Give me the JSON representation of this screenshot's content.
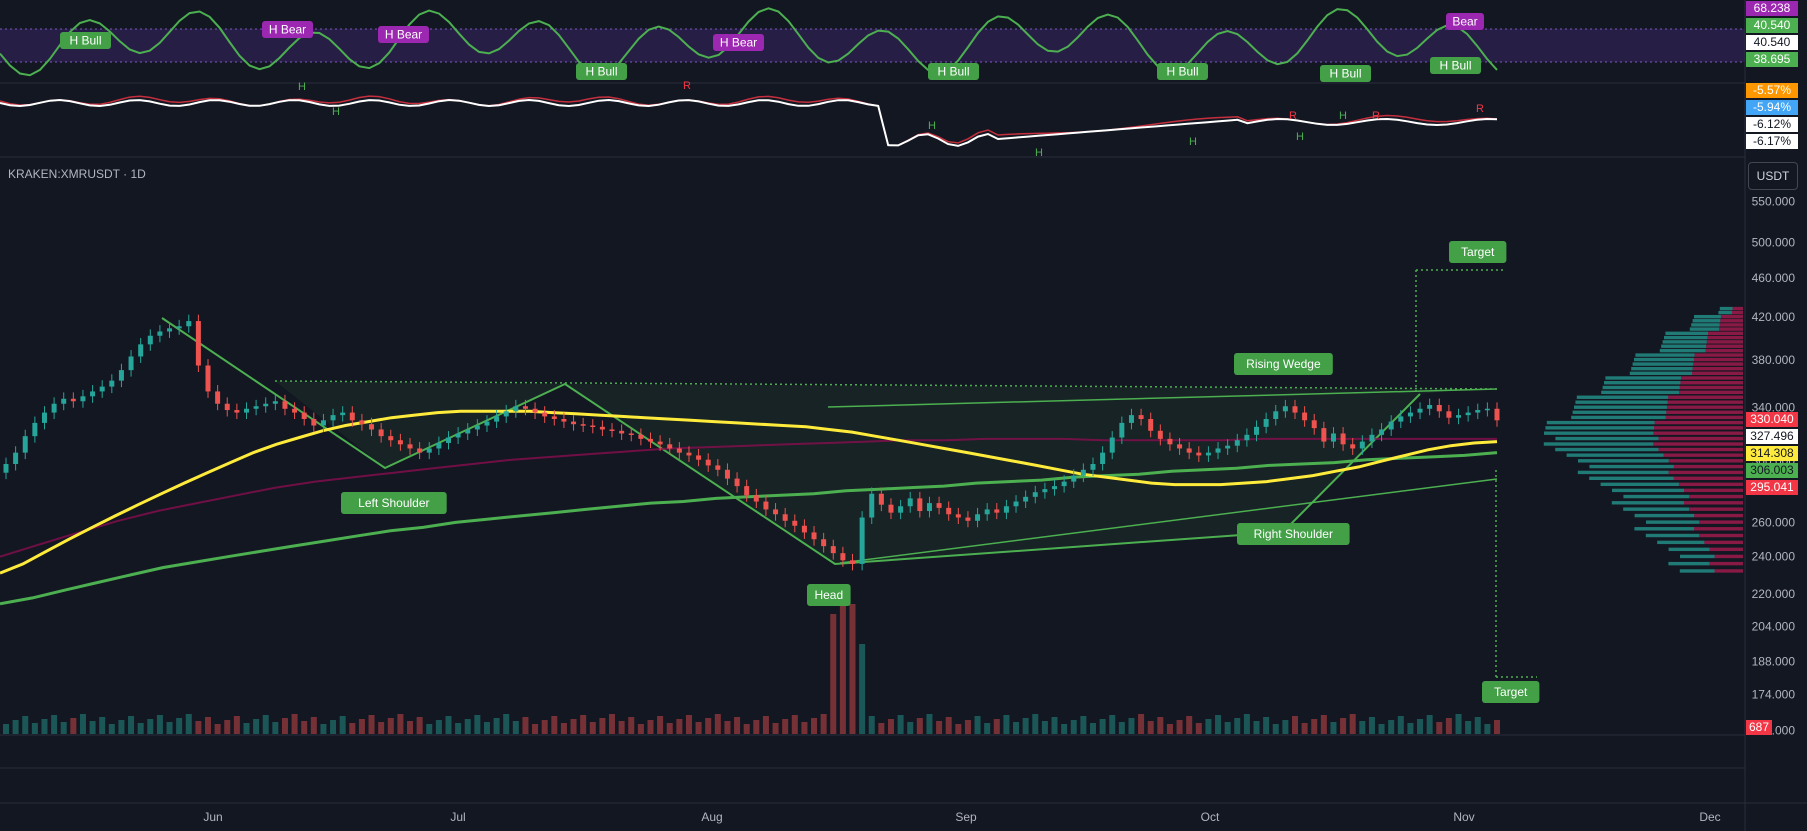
{
  "symbol": "KRAKEN:XMRUSDT · 1D",
  "currency_button": "USDT",
  "colors": {
    "background": "#131722",
    "up": "#26a69a",
    "down": "#ef5350",
    "pattern": "#4caf50",
    "ema_fast": "#ffeb3b",
    "rsi": "#4caf50",
    "bear_tag": "#9c27b0",
    "bull_tag": "#43a047"
  },
  "rsi_panel": {
    "divergence_labels": [
      "H Bull",
      "H Bear",
      "H Bear",
      "H Bull",
      "H Bear",
      "H Bull",
      "H Bull",
      "H Bull",
      "H Bull",
      "Bear"
    ],
    "scale_badges": [
      "68.238",
      "40.540",
      "40.540",
      "38.695"
    ]
  },
  "osc_panel": {
    "markers": [
      "H",
      "H",
      "R",
      "H",
      "H",
      "H",
      "R",
      "H",
      "H",
      "R",
      "R"
    ],
    "scale_badges": [
      "-5.57%",
      "-5.94%",
      "-6.12%",
      "-6.17%"
    ]
  },
  "chart_data": {
    "type": "candlestick",
    "title": "KRAKEN:XMRUSDT · 1D",
    "x_axis_labels": [
      "Jun",
      "Jul",
      "Aug",
      "Sep",
      "Oct",
      "Nov",
      "Dec"
    ],
    "y_axis_ticks": [
      "550.000",
      "500.000",
      "460.000",
      "420.000",
      "380.000",
      "340.000",
      "300.000",
      "260.000",
      "240.000",
      "220.000",
      "204.000",
      "188.000",
      "174.000",
      "160.000"
    ],
    "y_tick_values": [
      550,
      500,
      460,
      420,
      380,
      340,
      300,
      260,
      240,
      220,
      204,
      188,
      174,
      160
    ],
    "y_scale": "log",
    "price_badges": [
      {
        "text": "330.040",
        "color": "#f23645"
      },
      {
        "text": "327.496",
        "color": "#ffffff"
      },
      {
        "text": "314.308",
        "color": "#ffeb3b"
      },
      {
        "text": "306.003",
        "color": "#4caf50"
      },
      {
        "text": "295.041",
        "color": "#f23645"
      }
    ],
    "volume_badge": "687",
    "closes": [
      298,
      306,
      318,
      328,
      336,
      343,
      347,
      345,
      349,
      353,
      357,
      362,
      371,
      383,
      394,
      402,
      406,
      409,
      411,
      416,
      375,
      353,
      343,
      338,
      336,
      339,
      341,
      343,
      345,
      339,
      336,
      331,
      326,
      330,
      334,
      336,
      330,
      327,
      323,
      318,
      315,
      312,
      309,
      306,
      309,
      313,
      317,
      320,
      323,
      326,
      329,
      333,
      337,
      341,
      339,
      336,
      333,
      331,
      329,
      327,
      326,
      325,
      323,
      322,
      320,
      319,
      316,
      314,
      312,
      309,
      306,
      304,
      301,
      297,
      294,
      288,
      283,
      277,
      273,
      268,
      265,
      261,
      258,
      254,
      250,
      246,
      242,
      238,
      236,
      263,
      278,
      271,
      266,
      270,
      275,
      267,
      272,
      269,
      265,
      263,
      261,
      265,
      268,
      266,
      270,
      273,
      276,
      279,
      281,
      283,
      286,
      290,
      294,
      298,
      306,
      317,
      328,
      334,
      331,
      322,
      316,
      312,
      309,
      306,
      304,
      306,
      309,
      311,
      315,
      319,
      325,
      331,
      337,
      341,
      336,
      330,
      324,
      314,
      320,
      312,
      309,
      314,
      319,
      323,
      329,
      333,
      336,
      339,
      342,
      337,
      332,
      334,
      336,
      338,
      339,
      330
    ],
    "ema_fast": [
      231,
      236,
      243,
      250,
      257,
      264,
      271,
      278,
      285,
      292,
      299,
      306,
      312,
      317,
      322,
      326,
      329,
      332,
      334,
      336,
      337,
      337,
      337,
      337,
      336,
      335,
      334,
      333,
      332,
      331,
      330,
      329,
      328,
      327,
      326,
      325,
      323,
      321,
      318,
      315,
      312,
      309,
      306,
      303,
      300,
      297,
      294,
      291,
      289,
      287,
      285,
      284,
      284,
      284,
      285,
      286,
      288,
      290,
      293,
      296,
      300,
      304,
      308,
      311,
      313,
      314
    ],
    "sma_long": [
      240,
      247,
      254,
      261,
      267,
      272,
      277,
      282,
      286,
      289,
      292,
      295,
      298,
      301,
      303,
      305,
      307,
      309,
      310,
      311,
      312,
      313,
      314,
      315,
      315,
      316,
      316,
      316,
      315,
      315,
      315,
      315,
      316,
      316,
      316,
      316,
      316,
      316,
      316
    ],
    "ema_slow": [
      215,
      218,
      222,
      226,
      230,
      234,
      237,
      240,
      243,
      246,
      249,
      252,
      255,
      257,
      260,
      262,
      264,
      266,
      268,
      270,
      272,
      273,
      275,
      276,
      277,
      278,
      280,
      281,
      282,
      283,
      285,
      286,
      287,
      289,
      290,
      291,
      293,
      294,
      295,
      297,
      298,
      299,
      301,
      302,
      303,
      304,
      306
    ],
    "pattern_labels": {
      "left_shoulder": "Left Shoulder",
      "head": "Head",
      "right_shoulder": "Right Shoulder",
      "rising_wedge": "Rising Wedge",
      "target_up": "Target",
      "target_down": "Target"
    },
    "pattern_points": {
      "neckline_price": 356,
      "target_up_price": 475,
      "target_down_price": 178
    }
  }
}
